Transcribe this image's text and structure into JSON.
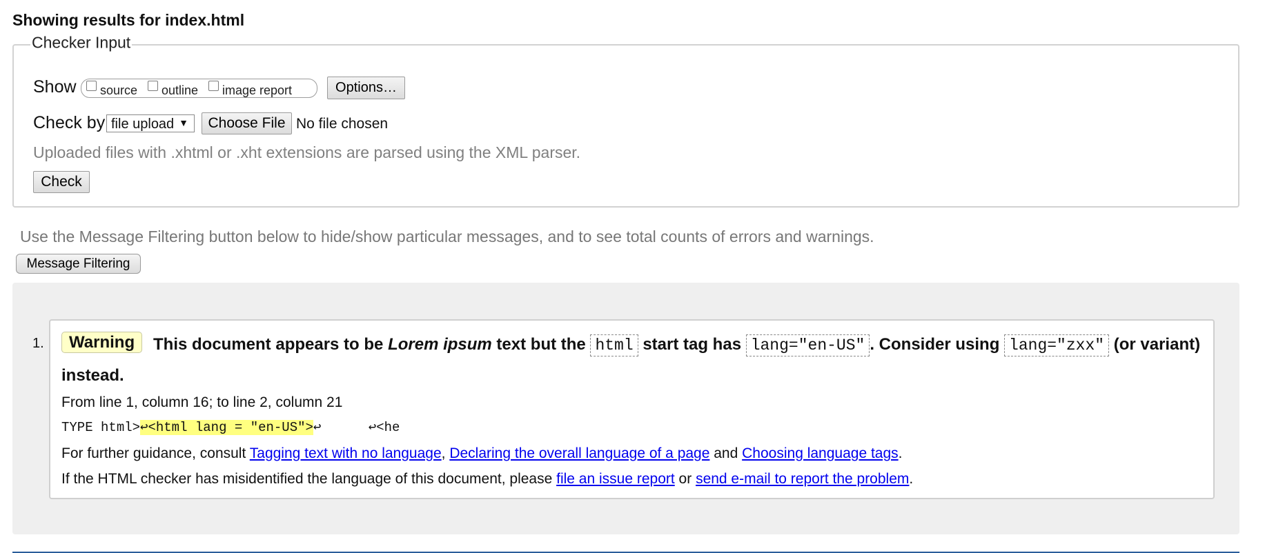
{
  "heading": "Showing results for index.html",
  "checker": {
    "legend": "Checker Input",
    "show_label": "Show",
    "show_options": [
      {
        "label": "source",
        "checked": false
      },
      {
        "label": "outline",
        "checked": false
      },
      {
        "label": "image report",
        "checked": false
      }
    ],
    "options_button": "Options…",
    "check_by_label": "Check by",
    "check_by_value": "file upload",
    "choose_file_button": "Choose File",
    "no_file_text": "No file chosen",
    "xml_hint": "Uploaded files with .xhtml or .xht extensions are parsed using the XML parser.",
    "check_button": "Check"
  },
  "filter_hint": "Use the Message Filtering button below to hide/show particular messages, and to see total counts of errors and warnings.",
  "filter_button": "Message Filtering",
  "message": {
    "number": "1.",
    "badge": "Warning",
    "title_part1": "This document appears to be ",
    "title_em": "Lorem ipsum",
    "title_part2": " text but the ",
    "code1": "html",
    "title_part3": " start tag has ",
    "code2": "lang=\"en-US\"",
    "title_part4": ". Consider using ",
    "code3": "lang=\"zxx\"",
    "title_part5": " (or variant) instead.",
    "location": "From line 1, column 16; to line 2, column 21",
    "extract_pre": "TYPE html>",
    "extract_hl": "↩<html lang = \"en-US\">",
    "extract_post": "↩      ↩<he",
    "guidance_prefix": "For further guidance, consult ",
    "guidance_link1": "Tagging text with no language",
    "guidance_sep": ", ",
    "guidance_link2": "Declaring the overall language of a page",
    "guidance_and": " and ",
    "guidance_link3": "Choosing language tags",
    "guidance_end": ".",
    "report_prefix": "If the HTML checker has misidentified the language of this document, please ",
    "report_link1": "file an issue report",
    "report_or": " or ",
    "report_link2": "send e-mail to report the problem",
    "report_end": "."
  },
  "colors": {
    "warning_badge_bg": "#ffffc8",
    "highlight": "#ffff80",
    "link": "#0000ee",
    "results_bg": "#efefef"
  }
}
